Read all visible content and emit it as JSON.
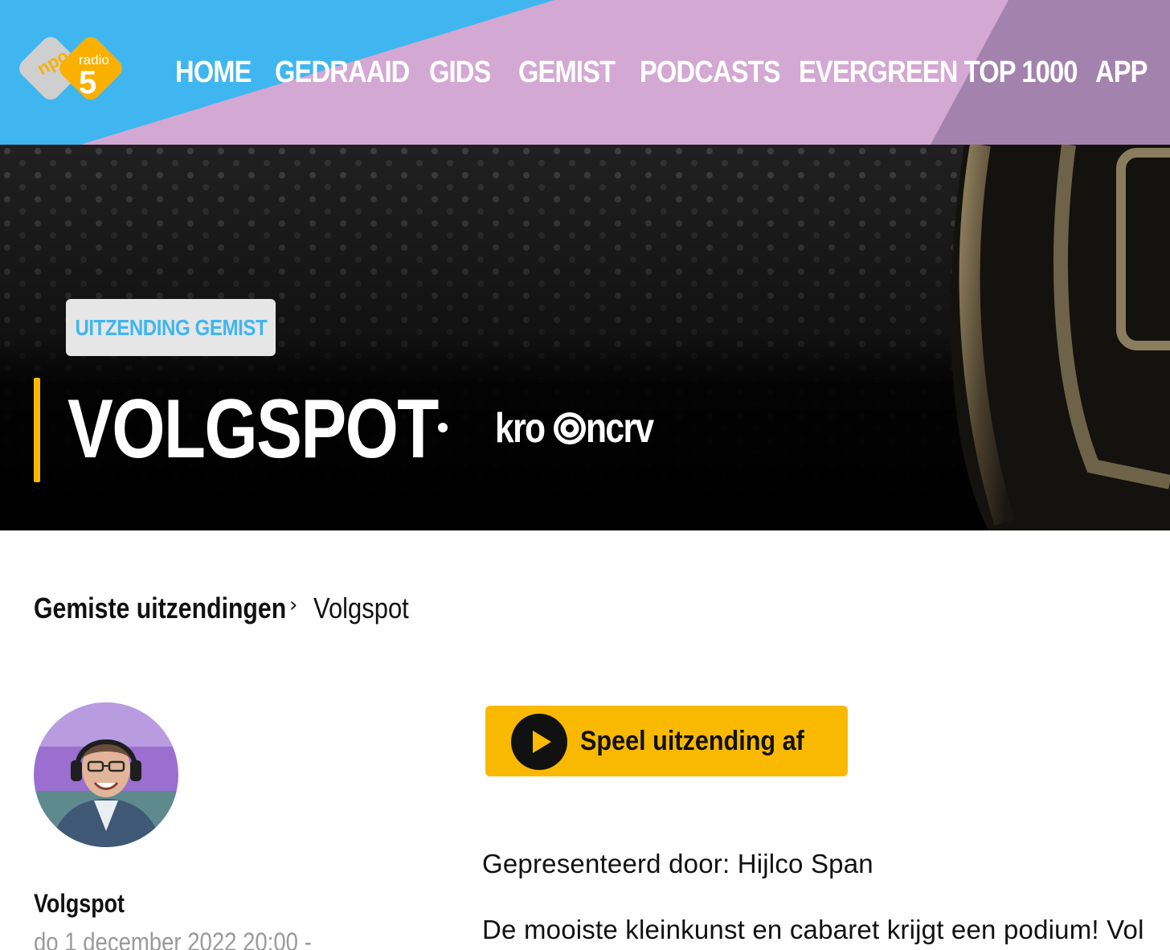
{
  "colors": {
    "header_blue": "#3fb6ef",
    "header_pink": "#d3a8d2",
    "header_purple": "#a383ae",
    "accent_yellow": "#f9b900",
    "badge_text": "#3fb6ef",
    "logo_orange": "#f9b000",
    "logo_gray": "#cfcfcf"
  },
  "logo": {
    "brand_small": "npo",
    "brand_radio": "radio",
    "brand_number": "5"
  },
  "nav": {
    "items": [
      {
        "label": "HOME"
      },
      {
        "label": "GEDRAAID"
      },
      {
        "label": "GIDS"
      },
      {
        "label": "GEMIST"
      },
      {
        "label": "PODCASTS"
      },
      {
        "label": "EVERGREEN TOP 1000"
      },
      {
        "label": "APP"
      }
    ]
  },
  "hero": {
    "badge": "UITZENDING GEMIST",
    "title": "VOLGSPOT",
    "broadcaster_part1": "kro",
    "broadcaster_part2": "ncrv"
  },
  "breadcrumb": {
    "parent": "Gemiste uitzendingen",
    "separator": "›",
    "current": "Volgspot"
  },
  "show": {
    "name": "Volgspot",
    "date": "do 1 december 2022 20:00 -"
  },
  "player": {
    "play_label": "Speel uitzending af"
  },
  "content": {
    "presenter": "Gepresenteerd door: Hijlco Span",
    "description": "De mooiste kleinkunst en cabaret krijgt een podium! Vol"
  }
}
